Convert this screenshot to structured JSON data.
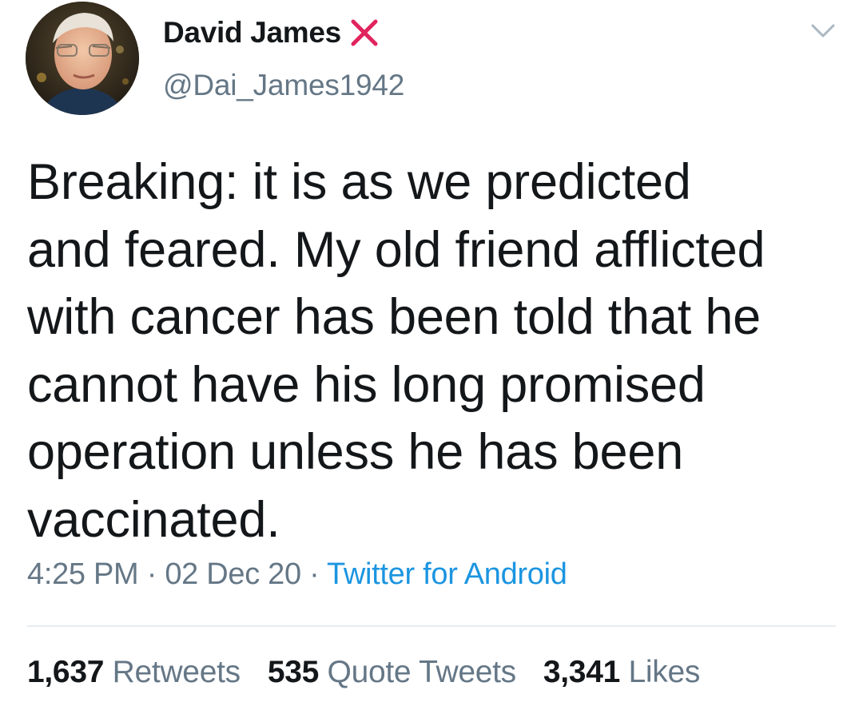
{
  "user": {
    "display_name": "David James",
    "handle": "@Dai_James1942",
    "badge_icon": "red-x-icon",
    "badge_color": "#e0245e"
  },
  "tweet": {
    "text": "Breaking: it is as we predicted\nand feared. My old friend afflicted\nwith cancer has been told that he\ncannot have his long promised\noperation unless he has been\nvaccinated."
  },
  "meta": {
    "time": "4:25 PM",
    "date": "02 Dec 20",
    "separator": "·",
    "source": "Twitter for Android"
  },
  "stats": {
    "retweets_count": "1,637",
    "retweets_label": "Retweets",
    "quote_count": "535",
    "quote_label": "Quote Tweets",
    "likes_count": "3,341",
    "likes_label": "Likes"
  },
  "colors": {
    "text": "#14171a",
    "secondary": "#657786",
    "link": "#1b95e0",
    "divider": "#e6ecf0"
  },
  "icons": {
    "caret": "chevron-down-icon"
  }
}
